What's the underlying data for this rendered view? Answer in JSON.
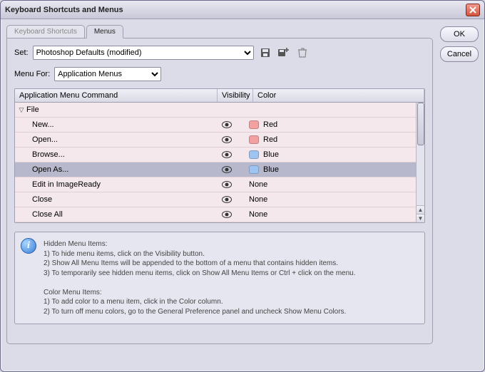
{
  "window": {
    "title": "Keyboard Shortcuts and Menus"
  },
  "buttons": {
    "ok": "OK",
    "cancel": "Cancel"
  },
  "tabs": {
    "shortcuts": "Keyboard Shortcuts",
    "menus": "Menus",
    "active": "menus"
  },
  "set": {
    "label": "Set:",
    "value": "Photoshop Defaults (modified)"
  },
  "toolbar_icons": {
    "save": "save-icon",
    "new_set": "new-set-icon",
    "delete": "trash-icon"
  },
  "menu_for": {
    "label": "Menu For:",
    "value": "Application Menus"
  },
  "columns": {
    "command": "Application Menu Command",
    "visibility": "Visibility",
    "color": "Color"
  },
  "group": {
    "name": "File",
    "expanded": true
  },
  "rows": [
    {
      "label": "New...",
      "visible": true,
      "color_name": "Red",
      "swatch": "red",
      "selected": false
    },
    {
      "label": "Open...",
      "visible": true,
      "color_name": "Red",
      "swatch": "red",
      "selected": false
    },
    {
      "label": "Browse...",
      "visible": true,
      "color_name": "Blue",
      "swatch": "blue",
      "selected": false
    },
    {
      "label": "Open As...",
      "visible": true,
      "color_name": "Blue",
      "swatch": "blue",
      "selected": true
    },
    {
      "label": "Edit in ImageReady",
      "visible": true,
      "color_name": "None",
      "swatch": "",
      "selected": false
    },
    {
      "label": "Close",
      "visible": true,
      "color_name": "None",
      "swatch": "",
      "selected": false
    },
    {
      "label": "Close All",
      "visible": true,
      "color_name": "None",
      "swatch": "",
      "selected": false
    }
  ],
  "info": {
    "hidden_title": "Hidden Menu Items:",
    "hidden_1": "1) To hide menu items, click on the Visibility button.",
    "hidden_2": "2) Show All Menu Items will be appended to the bottom of a menu that contains hidden items.",
    "hidden_3": "3) To temporarily see hidden menu items, click on Show All Menu Items or Ctrl + click on the menu.",
    "color_title": "Color Menu Items:",
    "color_1": "1) To add color to a menu item, click in the Color column.",
    "color_2": "2) To turn off menu colors, go to the General Preference panel and uncheck Show Menu Colors."
  }
}
